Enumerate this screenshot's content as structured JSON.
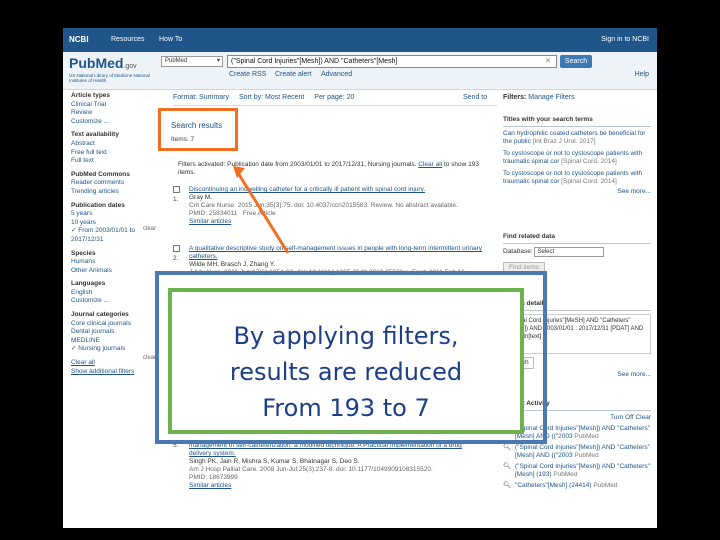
{
  "ncbi_bar": {
    "logo": "NCBI",
    "resources": "Resources",
    "howto": "How To",
    "signin": "Sign in to NCBI"
  },
  "header": {
    "logo_main": "PubMed",
    "logo_suffix": ".gov",
    "sub": "US National Library of Medicine National Institutes of Health",
    "db_value": "PubMed",
    "query_value": "(\"Spinal Cord Injuries\"[Mesh]) AND \"Catheters\"[Mesh]",
    "search_label": "Search",
    "create_rss": "Create RSS",
    "create_alert": "Create alert",
    "advanced": "Advanced",
    "help": "Help"
  },
  "facets": {
    "article_types_h": "Article types",
    "article_types": [
      "Clinical Trial",
      "Review",
      "Customize ..."
    ],
    "text_availability_h": "Text availability",
    "text_availability": [
      "Abstract",
      "Free full text",
      "Full text"
    ],
    "pubmed_commons_h": "PubMed Commons",
    "pubmed_commons": [
      "Reader comments",
      "Trending articles"
    ],
    "pub_dates_h": "Publication dates",
    "pub_dates": [
      "5 years",
      "10 years"
    ],
    "pub_dates_sel": "From 2003/01/01 to 2017/12/31",
    "species_h": "Species",
    "species": [
      "Humans",
      "Other Animals"
    ],
    "languages_h": "Languages",
    "languages": [
      "English",
      "Customize ..."
    ],
    "journal_h": "Journal categories",
    "journal": [
      "Core clinical journals",
      "Dental journals",
      "MEDLINE"
    ],
    "journal_sel": "Nursing journals",
    "clear_all": "Clear all",
    "show_additional": "Show additional filters",
    "side_clear": "clear"
  },
  "results": {
    "format": "Format: Summary",
    "sort": "Sort by: Most Recent",
    "per_page": "Per page: 20",
    "send_to": "Send to",
    "title": "Search results",
    "items": "Items: 7",
    "filter_msg_a": "Filters activated: Publication date from 2003/01/01 to 2017/12/31, Nursing journals.",
    "filter_clear": "Clear all",
    "filter_msg_b": "to show 193 items.",
    "r1_title": "Discontinuing an indwelling catheter for a critically ill patient with spinal cord injury.",
    "r1_authors": "Gray M.",
    "r1_journal": "Crit Care Nurse. 2015 Jun;35(3):75. doi: 10.4037/ccn2015583. Review. No abstract available.",
    "r1_pmid": "PMID: 25834011",
    "r1_free": "Free Article",
    "r1_similar": "Similar articles",
    "r2_title": "A qualitative descriptive study on self-management issues in people with long-term intermittent urinary catheters.",
    "r2_authors": "Wilde MH, Brasch J, Zhang Y.",
    "r2_journal": "J Adv Nurs. 2011 Jun;67(6):1254-63. doi: 10.1111/j.1365-2648.2010.05583.x. Epub 2011 Feb 16.",
    "r5_title_a": "management of self-catheterization: a modified technique. A Practical Implementation of a drug",
    "r5_title_b": "delivery system.",
    "r5_authors": "Singh PK, Jain R, Mishra S, Kumar S, Bhatnagar S, Deo S.",
    "r5_journal": "Am J Hosp Palliat Care. 2008 Jun-Jul;25(3):237-8. doi: 10.1177/1049909108315520.",
    "r5_pmid": "PMID: 18673999",
    "r5_similar": "Similar articles",
    "num1": "1.",
    "num2": "2.",
    "num5": "5."
  },
  "sidebar": {
    "filters_label": "Filters:",
    "manage_filters": "Manage Filters",
    "titles_h": "Titles with your search terms",
    "t1": "Can hydrophilic coated catheters be beneficial for the public",
    "t1_src": "[Int Braz J Urol. 2017]",
    "t2": "To cystoscope or not to cystoscope patients with traumatic spinal cor",
    "t2_src": "[Spinal Cord. 2014]",
    "t3": "To cystoscope or not to cystoscope patients with traumatic spinal cor",
    "t3_src": "[Spinal Cord. 2014]",
    "see_more": "See more...",
    "related_h": "Find related data",
    "database_label": "Database:",
    "database_value": "Select",
    "find_items": "Find items",
    "details_h": "Search details",
    "details_text": "(\"Spinal Cord Injuries\"[MeSH] AND \"Catheters\"[MeSH]) AND 2003/01/01 : 2017/12/31 [PDAT] AND jsubsetn[text]",
    "details_search": "Search",
    "activity_h": "Recent Activity",
    "turn_off": "Turn Off",
    "clear": "Clear",
    "act1": "(\"Spinal Cord Injuries\"[Mesh]) AND \"Catheters\"[Mesh] AND ((\"2003",
    "act1_src": "PubMed",
    "act2": "(\"Spinal Cord Injuries\"[Mesh]) AND \"Catheters\"[Mesh] AND ((\"2003",
    "act2_src": "PubMed",
    "act3": "(\"Spinal Cord Injuries\"[Mesh]) AND \"Catheters\"[Mesh] (193)",
    "act3_src": "PubMed",
    "act4": "\"Catheters\"[Mesh] (24414)",
    "act4_src": "PubMed"
  },
  "overlay": {
    "line1": "By applying filters,",
    "line2": "results are reduced",
    "line3": "From 193 to 7"
  },
  "colors": {
    "highlight": "#f26f21",
    "ncbi_blue": "#20558a",
    "overlay_outer": "#4a78b0",
    "overlay_inner": "#6cb24d",
    "overlay_text": "#1c3e87"
  }
}
